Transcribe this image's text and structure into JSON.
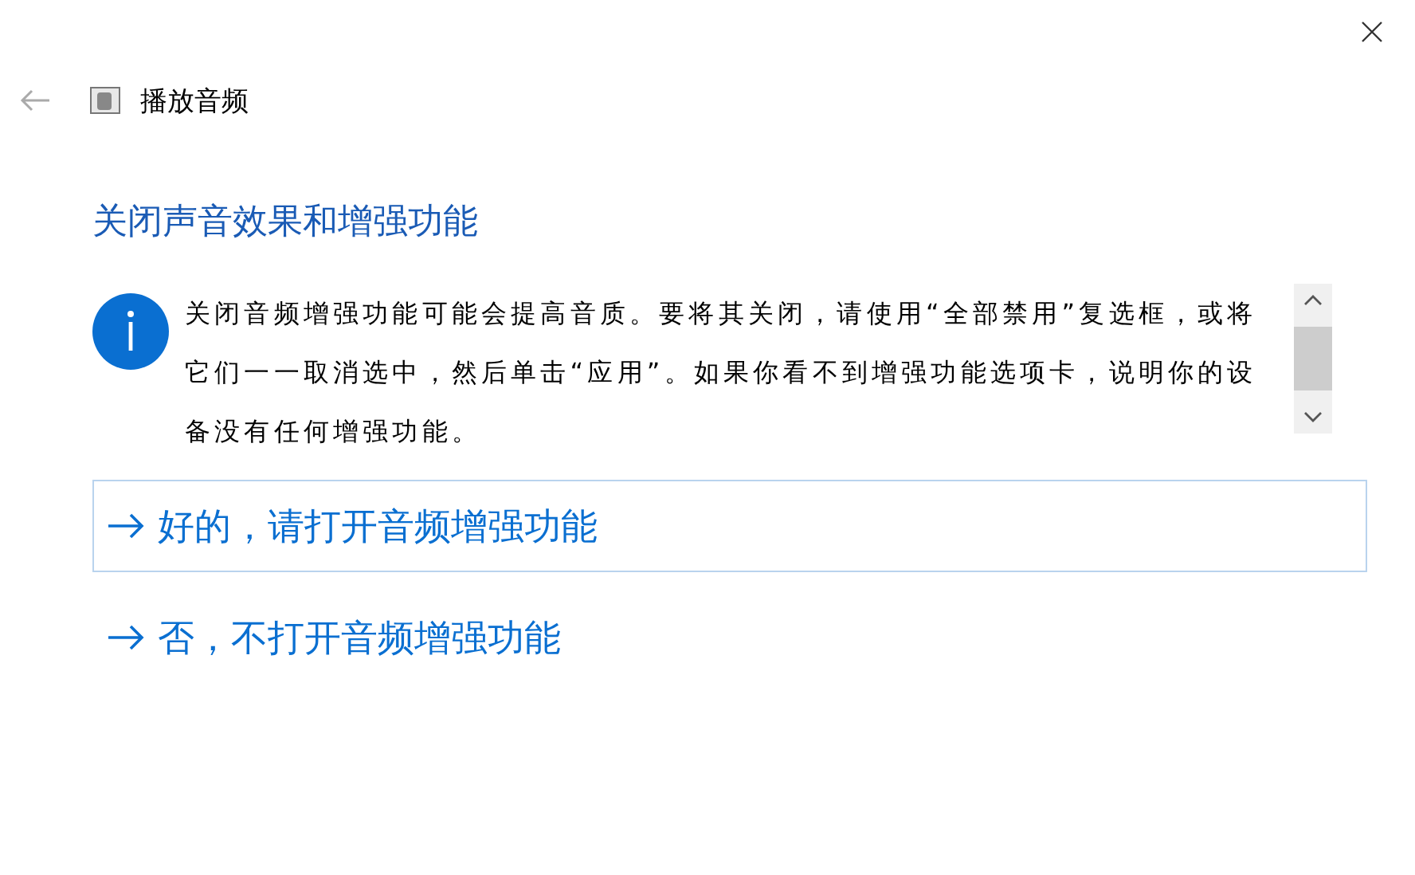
{
  "window": {
    "title": "播放音频"
  },
  "heading": "关闭声音效果和增强功能",
  "info": {
    "text": "关闭音频增强功能可能会提高音质。要将其关闭，请使用“全部禁用”复选框，或将它们一一取消选中，然后单击“应用”。如果你看不到增强功能选项卡，说明你的设备没有任何增强功能。"
  },
  "options": [
    {
      "label": "好的，请打开音频增强功能",
      "selected": true
    },
    {
      "label": "否，不打开音频增强功能",
      "selected": false
    }
  ]
}
